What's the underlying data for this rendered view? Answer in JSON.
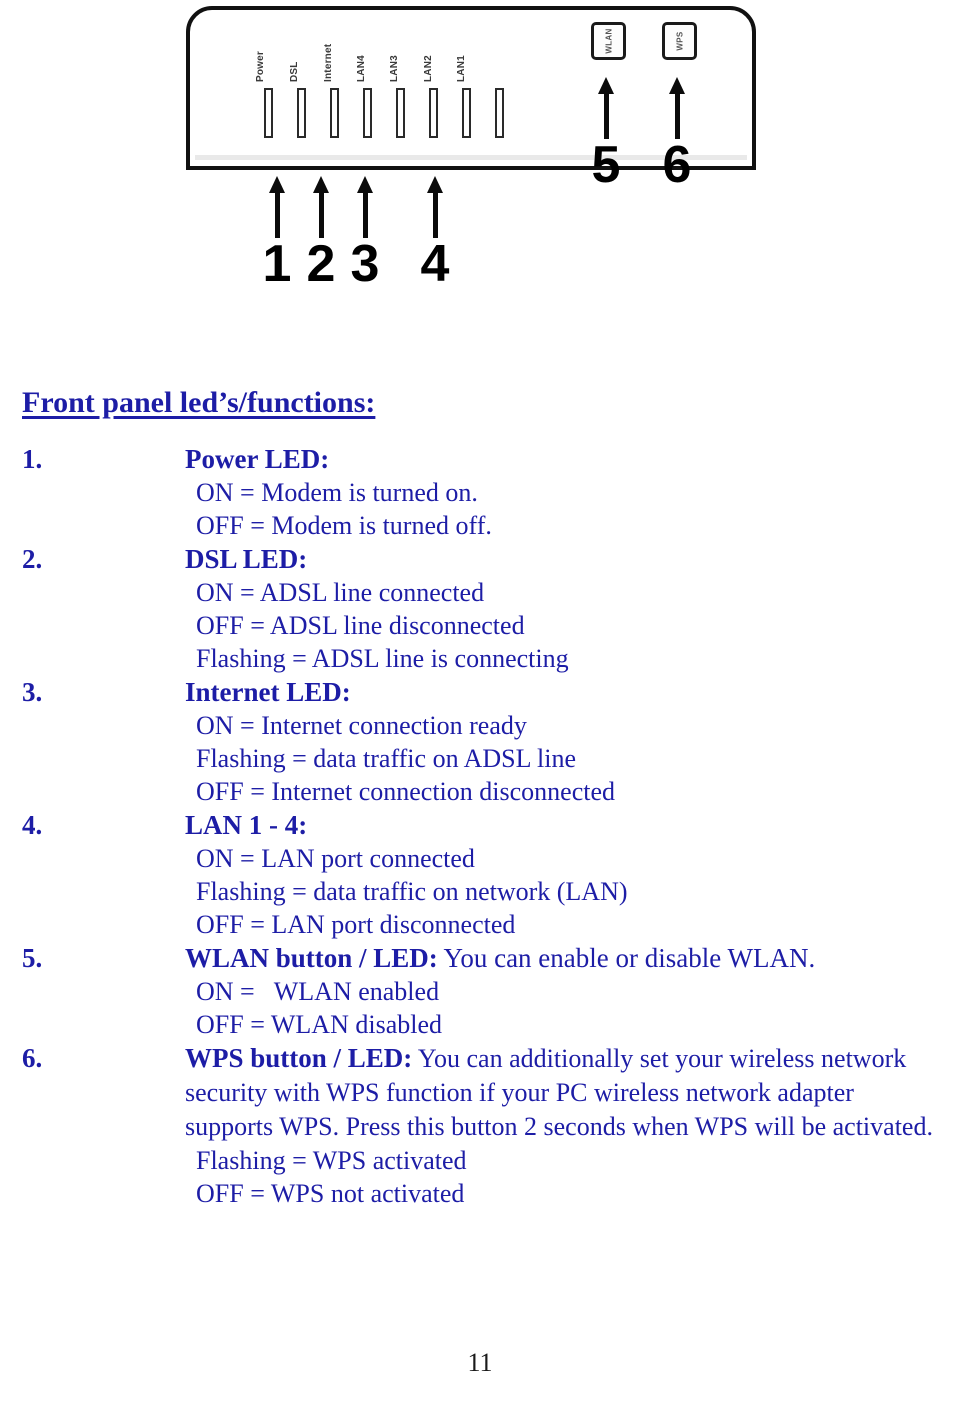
{
  "figure": {
    "name": "adsl-router-front-panel-diagram",
    "led_labels": [
      "Power",
      "DSL",
      "Internet",
      "LAN4",
      "LAN3",
      "LAN2",
      "LAN1"
    ],
    "led_slot_count": 8,
    "buttons": [
      {
        "label": "WLAN",
        "name": "wlan-button"
      },
      {
        "label": "WPS",
        "name": "wps-button"
      }
    ],
    "callouts": [
      {
        "number": "1"
      },
      {
        "number": "2"
      },
      {
        "number": "3"
      },
      {
        "number": "4"
      },
      {
        "number": "5"
      },
      {
        "number": "6"
      }
    ]
  },
  "document": {
    "heading": "Front panel led’s/functions:",
    "page_number": "11",
    "text_color": "#1d1da6",
    "items": [
      {
        "number": "1.",
        "title": "Power LED:",
        "title_rest": "",
        "lines": [
          "ON = Modem is turned on.",
          "OFF = Modem is turned off."
        ]
      },
      {
        "number": "2.",
        "title": "DSL LED:",
        "title_rest": "",
        "lines": [
          "ON = ADSL line connected",
          "OFF = ADSL line disconnected",
          "Flashing = ADSL line is connecting"
        ]
      },
      {
        "number": "3.",
        "title": "Internet LED:",
        "title_rest": "",
        "lines": [
          "ON = Internet connection ready",
          "Flashing = data traffic on ADSL line",
          "OFF = Internet connection disconnected"
        ]
      },
      {
        "number": "4.",
        "title": "LAN 1 - 4:",
        "title_rest": "",
        "lines": [
          "ON = LAN port connected",
          "Flashing = data traffic on network (LAN)",
          "OFF = LAN port disconnected"
        ]
      },
      {
        "number": "5.",
        "title": "WLAN button / LED:",
        "title_rest": " You can enable or disable WLAN.",
        "lines": [
          "ON =   WLAN enabled",
          "OFF = WLAN disabled"
        ]
      },
      {
        "number": "6.",
        "title": "WPS button / LED:",
        "title_rest": " You can additionally set your wireless network security with WPS function if your PC wireless network adapter supports WPS. Press this button 2 seconds when WPS will be activated.",
        "lines": [
          "Flashing = WPS activated",
          "OFF = WPS not activated"
        ]
      }
    ]
  }
}
